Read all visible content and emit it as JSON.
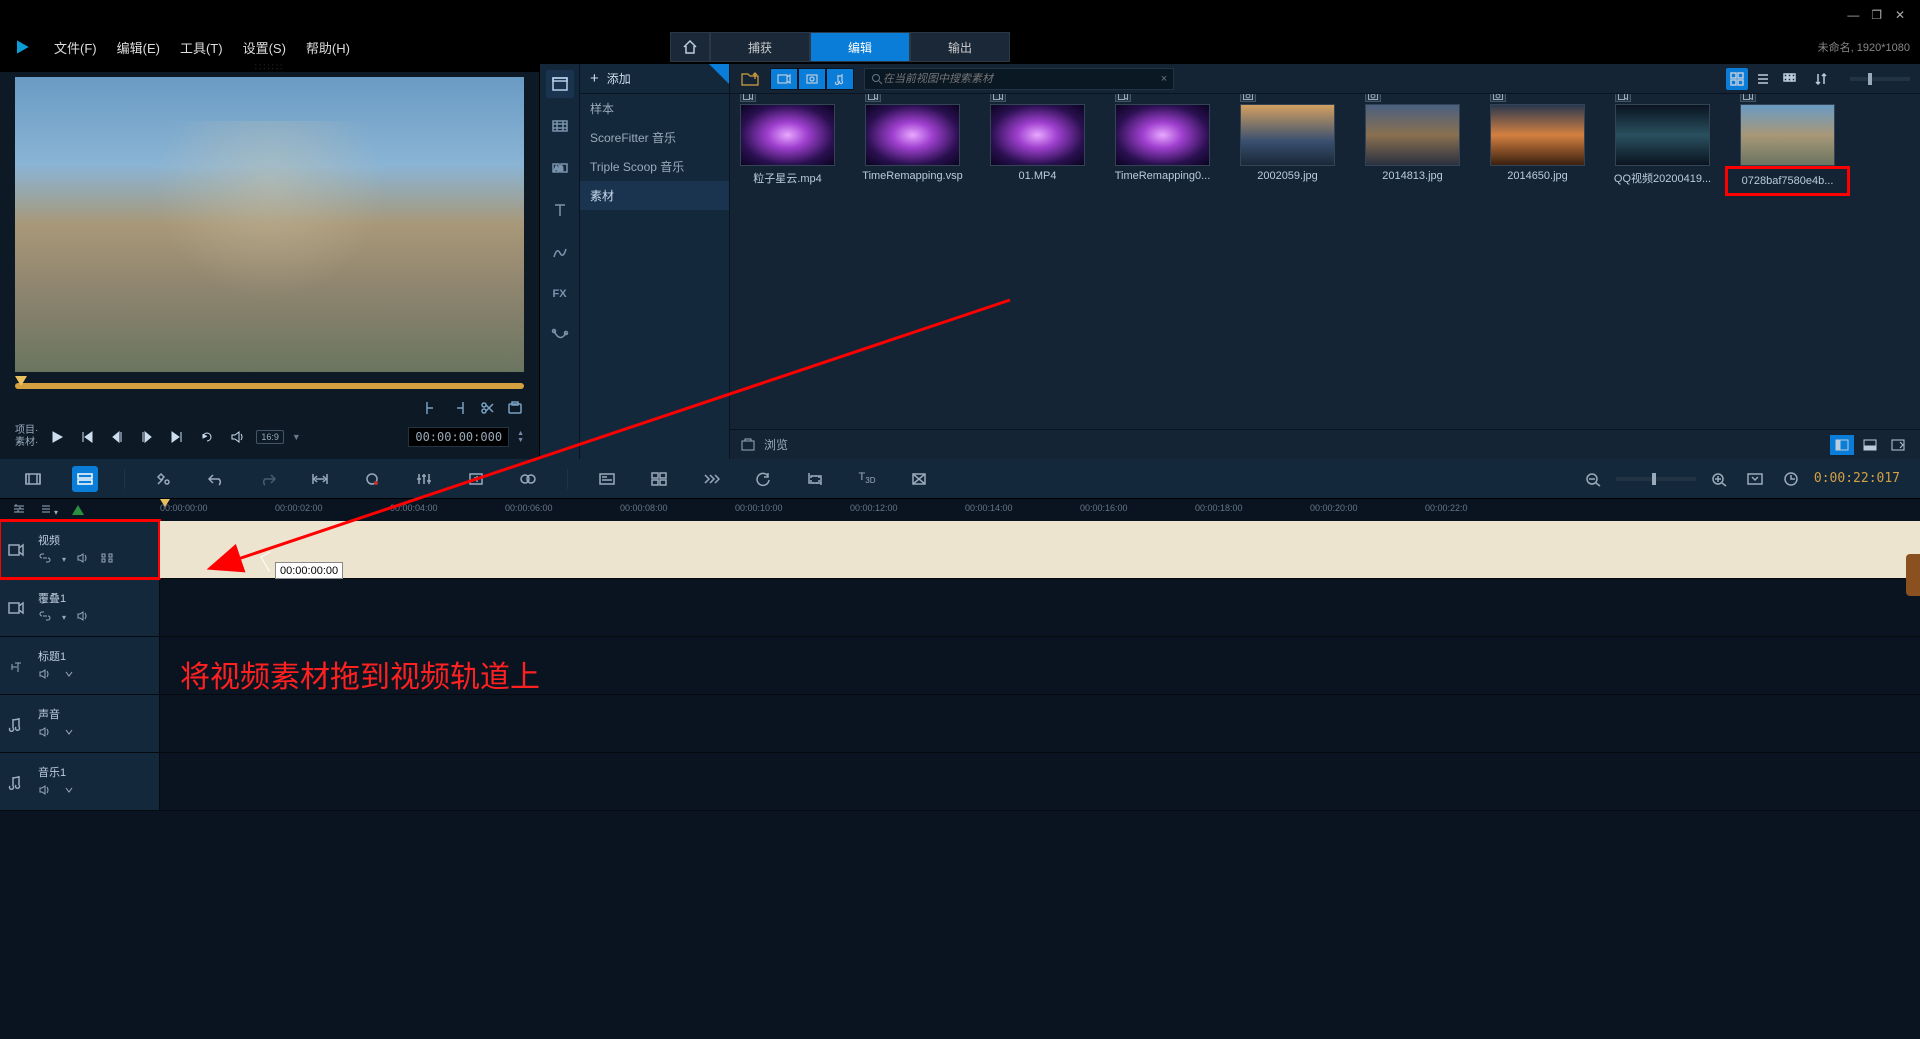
{
  "window_controls": {
    "min": "—",
    "max": "❐",
    "close": "✕"
  },
  "menu": {
    "items": [
      "文件(F)",
      "编辑(E)",
      "工具(T)",
      "设置(S)",
      "帮助(H)"
    ],
    "tabs": {
      "home": "⌂",
      "capture": "捕获",
      "edit": "编辑",
      "output": "输出"
    },
    "status": "未命名, 1920*1080"
  },
  "preview": {
    "label_project": "项目·",
    "label_clip": "素材·",
    "ratio": "16:9",
    "timecode": "00:00:00:000"
  },
  "library": {
    "add_label": "添加",
    "tree": [
      "样本",
      "ScoreFitter 音乐",
      "Triple Scoop 音乐",
      "素材"
    ],
    "tree_active": 3,
    "search_placeholder": "在当前视图中搜索素材",
    "items": [
      {
        "name": "粒子星云.mp4",
        "cls": "galaxy",
        "type": "vid"
      },
      {
        "name": "TimeRemapping.vsp",
        "cls": "galaxy",
        "type": "vid"
      },
      {
        "name": "01.MP4",
        "cls": "galaxy",
        "type": "vid"
      },
      {
        "name": "TimeRemapping0...",
        "cls": "galaxy",
        "type": "vid"
      },
      {
        "name": "2002059.jpg",
        "cls": "city1",
        "type": "img"
      },
      {
        "name": "2014813.jpg",
        "cls": "city2",
        "type": "img"
      },
      {
        "name": "2014650.jpg",
        "cls": "sunset",
        "type": "img"
      },
      {
        "name": "QQ视频20200419...",
        "cls": "room",
        "type": "vid"
      },
      {
        "name": "0728baf7580e4b...",
        "cls": "fountain",
        "type": "vid",
        "highlight": true
      }
    ],
    "browse": "浏览"
  },
  "timeline": {
    "duration": "0:00:22:017",
    "ruler_ticks": [
      "00:00:00:00",
      "00:00:02:00",
      "00:00:04:00",
      "00:00:06:00",
      "00:00:08:00",
      "00:00:10:00",
      "00:00:12:00",
      "00:00:14:00",
      "00:00:16:00",
      "00:00:18:00",
      "00:00:20:00",
      "00:00:22:0"
    ],
    "tracks": [
      {
        "label": "视频",
        "icon": "video"
      },
      {
        "label": "覆叠1",
        "icon": "video"
      },
      {
        "label": "标题1",
        "icon": "title"
      },
      {
        "label": "声音",
        "icon": "audio"
      },
      {
        "label": "音乐1",
        "icon": "music"
      }
    ],
    "drop_tc": "00:00:00:00"
  },
  "instruction": "将视频素材拖到视频轨道上"
}
